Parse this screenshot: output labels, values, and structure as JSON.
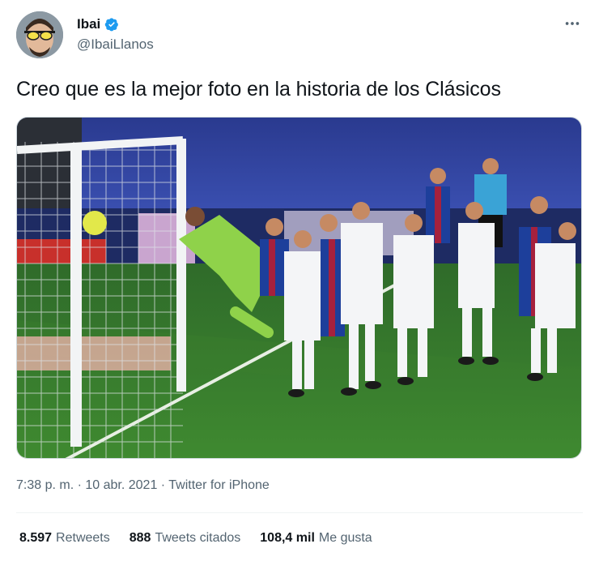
{
  "author": {
    "name": "Ibai",
    "handle": "@IbaiLlanos",
    "verified_badge_icon": "verified-badge-icon",
    "accent_color": "#1d9bf0"
  },
  "menu": {
    "icon": "more-options-icon"
  },
  "tweet": {
    "text": "Creo que es la mejor foto en la historia de los Clásicos"
  },
  "meta": {
    "time": "7:38 p. m.",
    "sep1": " · ",
    "date": "10 abr. 2021",
    "sep2": " · ",
    "source": "Twitter for iPhone"
  },
  "stats": {
    "retweets_num": "8.597",
    "retweets_label": "Retweets",
    "quotes_num": "888",
    "quotes_label": "Tweets citados",
    "likes_num": "108,4 mil",
    "likes_label": "Me gusta"
  }
}
